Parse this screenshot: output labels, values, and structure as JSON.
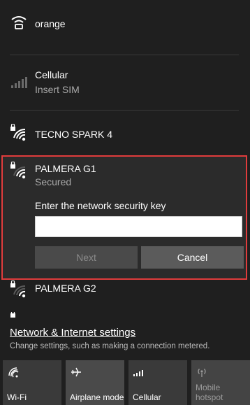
{
  "networks": {
    "orange": {
      "name": "orange"
    },
    "cellular": {
      "name": "Cellular",
      "status": "Insert SIM"
    },
    "tecno": {
      "name": "TECNO SPARK 4"
    },
    "palmera_g1": {
      "name": "PALMERA G1",
      "status": "Secured",
      "key_prompt": "Enter the network security key",
      "key_value": "",
      "next_label": "Next",
      "cancel_label": "Cancel"
    },
    "palmera_g2": {
      "name": "PALMERA G2"
    }
  },
  "settings": {
    "link": "Network & Internet settings",
    "description": "Change settings, such as making a connection metered."
  },
  "quick_actions": [
    {
      "label": "Wi-Fi",
      "icon": "wifi-icon"
    },
    {
      "label": "Airplane mode",
      "icon": "airplane-icon"
    },
    {
      "label": "Cellular",
      "icon": "cellular-icon"
    },
    {
      "label": "Mobile hotspot",
      "icon": "hotspot-icon"
    }
  ],
  "colors": {
    "panel_bg": "#1f1f1f",
    "highlight_border": "#e03c3c"
  }
}
